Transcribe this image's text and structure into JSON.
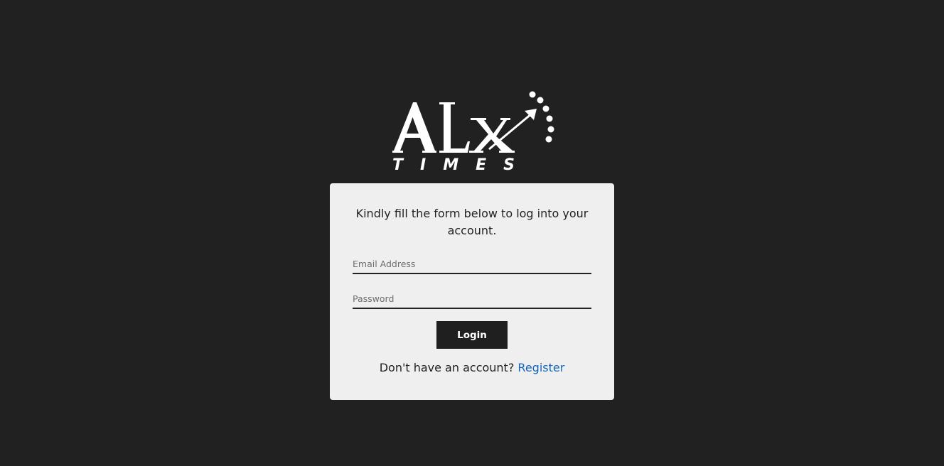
{
  "brand": {
    "logo_main": "ALX",
    "logo_sub": "TIMES"
  },
  "login_form": {
    "intro": "Kindly fill the form below to log into your account.",
    "email_placeholder": "Email Address",
    "password_placeholder": "Password",
    "login_label": "Login",
    "register_prompt": "Don't have an account?",
    "register_link": "Register"
  },
  "colors": {
    "background": "#212121",
    "card": "#efefef",
    "button": "#1f1f1f",
    "link": "#1565c0"
  }
}
